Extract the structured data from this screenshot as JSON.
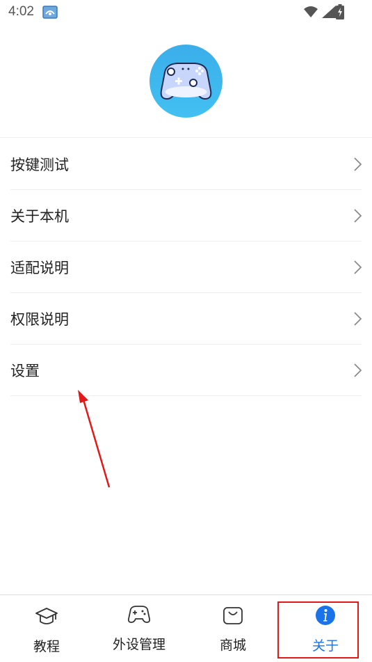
{
  "status_bar": {
    "time": "4:02"
  },
  "menu": {
    "items": [
      {
        "label": "按键测试"
      },
      {
        "label": "关于本机"
      },
      {
        "label": "适配说明"
      },
      {
        "label": "权限说明"
      },
      {
        "label": "设置"
      }
    ]
  },
  "tabs": [
    {
      "label": "教程",
      "icon": "graduation-cap-icon",
      "active": false
    },
    {
      "label": "外设管理",
      "icon": "gamepad-icon",
      "active": false
    },
    {
      "label": "商城",
      "icon": "shopping-bag-icon",
      "active": false
    },
    {
      "label": "关于",
      "icon": "info-icon",
      "active": true
    }
  ],
  "colors": {
    "accent": "#1a73e8",
    "annotation": "#e31818",
    "logo_bg": "#3db7ef"
  }
}
